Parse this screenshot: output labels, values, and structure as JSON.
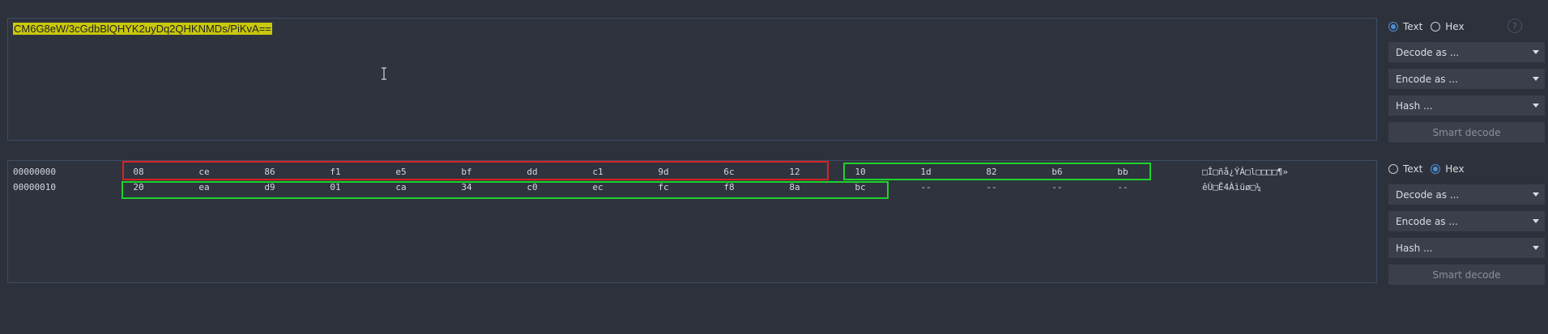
{
  "text_pane": {
    "content": "CM6G8eW/3cGdbBlQHYK2uyDq2QHKNMDs/PiKvA=="
  },
  "hex_pane": {
    "rows": [
      {
        "offset": "00000000",
        "bytes": [
          "08",
          "ce",
          "86",
          "f1",
          "e5",
          "bf",
          "dd",
          "c1",
          "9d",
          "6c",
          "12",
          "10",
          "1d",
          "82",
          "b6",
          "bb"
        ],
        "ascii": "□Î□ñå¿ÝÁ□l□□□□¶»"
      },
      {
        "offset": "00000010",
        "bytes": [
          "20",
          "ea",
          "d9",
          "01",
          "ca",
          "34",
          "c0",
          "ec",
          "fc",
          "f8",
          "8a",
          "bc",
          "--",
          "--",
          "--",
          "--"
        ],
        "ascii": " êÙ□Ê4Àìüø□¼"
      }
    ]
  },
  "side_text": {
    "radio_text": "Text",
    "radio_hex": "Hex",
    "selected": "text",
    "help": "?",
    "decode": "Decode as ...",
    "encode": "Encode as ...",
    "hash": "Hash ...",
    "smart": "Smart decode"
  },
  "side_hex": {
    "radio_text": "Text",
    "radio_hex": "Hex",
    "selected": "hex",
    "decode": "Decode as ...",
    "encode": "Encode as ...",
    "hash": "Hash ...",
    "smart": "Smart decode"
  },
  "colors": {
    "highlight_red": "#d52424",
    "highlight_green": "#1ed22d",
    "selection": "#c9c80d",
    "accent": "#4a90d9"
  }
}
